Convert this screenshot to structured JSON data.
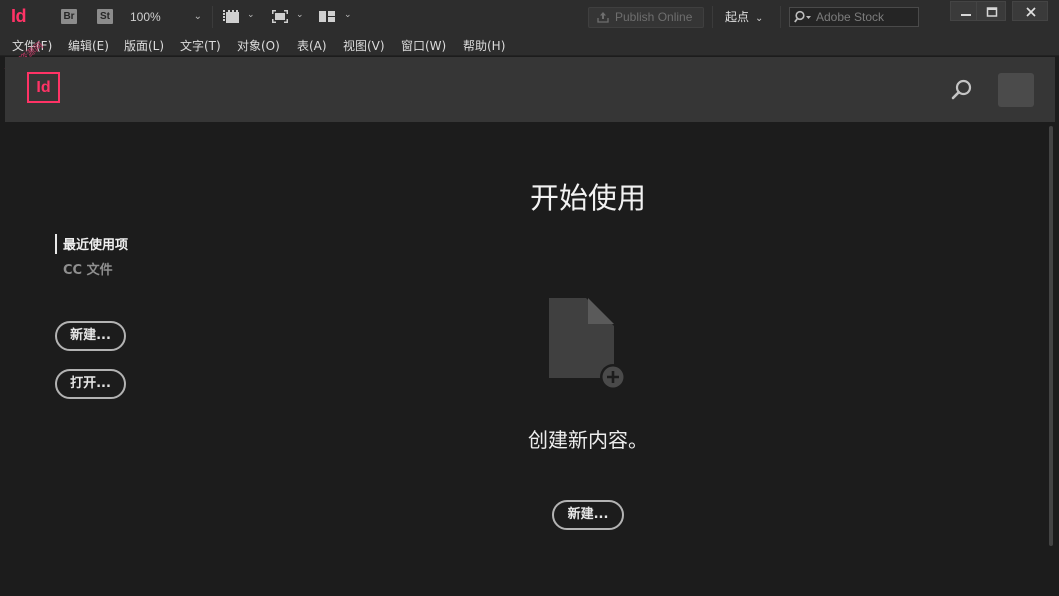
{
  "app": {
    "logo_text": "Id",
    "watermark": "起点资源网",
    "bridge_label": "Br",
    "stock_label": "St",
    "zoom_value": "100%",
    "publish_label": "Publish Online",
    "workspace_label": "起点",
    "search_placeholder": "Adobe Stock",
    "brand_color": "#ff3366"
  },
  "menu": {
    "items": [
      "文件(F)",
      "编辑(E)",
      "版面(L)",
      "文字(T)",
      "对象(O)",
      "表(A)",
      "视图(V)",
      "窗口(W)",
      "帮助(H)"
    ]
  },
  "header": {
    "logo_text": "Id",
    "search_icon": "search-icon",
    "profile_icon": "avatar"
  },
  "sidebar": {
    "nav": [
      "最近使用项",
      "CC 文件"
    ],
    "new_button": "新建...",
    "open_button": "打开..."
  },
  "main": {
    "title": "开始使用",
    "create_text": "创建新内容。",
    "new_button": "新建...",
    "doc_icon": "new-document-icon"
  }
}
